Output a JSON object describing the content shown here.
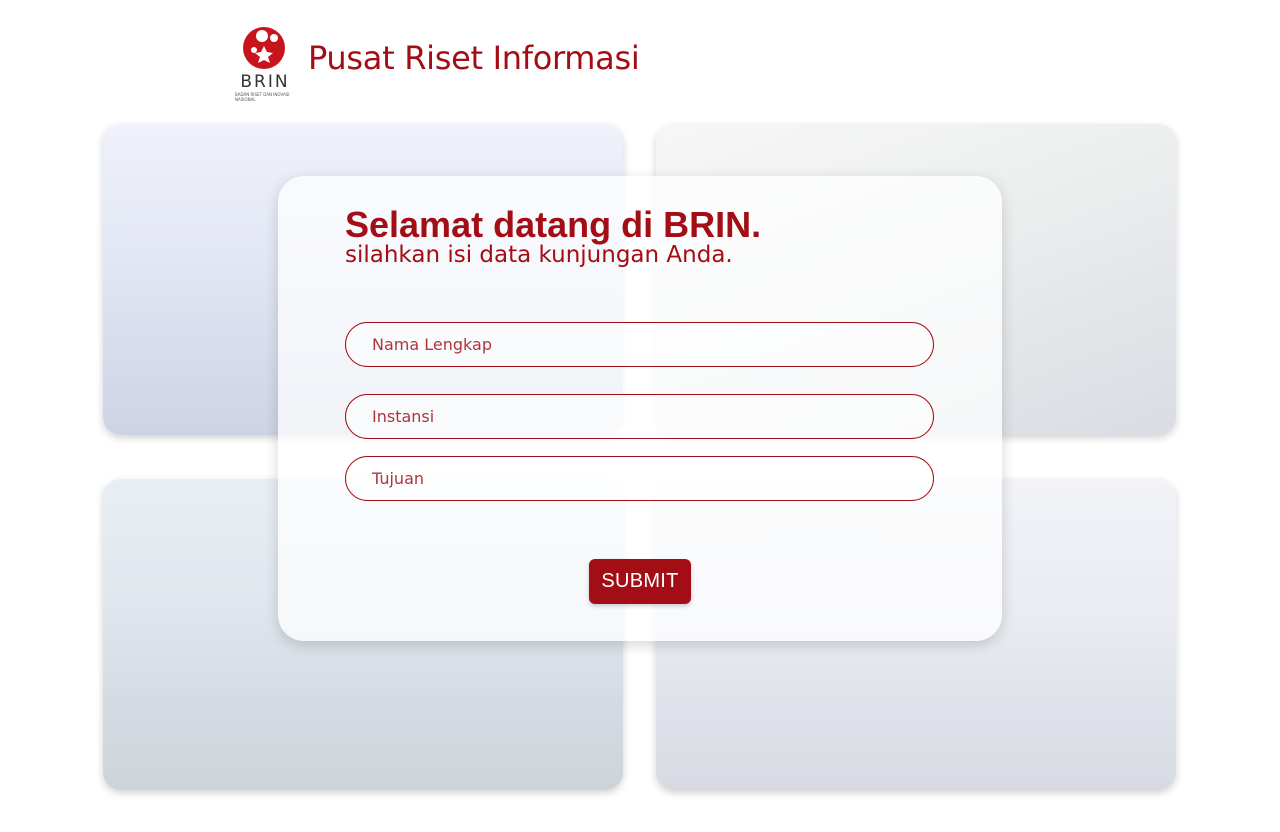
{
  "header": {
    "logo_word": "BRIN",
    "logo_subtext": "BADAN RISET DAN INOVASI NASIONAL",
    "title": "Pusat Riset Informasi"
  },
  "form": {
    "welcome": "Selamat datang di BRIN.",
    "subtitle": "silahkan isi data kunjungan Anda.",
    "fields": [
      {
        "placeholder": "Nama Lengkap",
        "value": ""
      },
      {
        "placeholder": "Instansi",
        "value": ""
      },
      {
        "placeholder": "Tujuan",
        "value": ""
      }
    ],
    "submit_label": "SUBMIT"
  },
  "colors": {
    "brand_red": "#a30d15",
    "background": "#ffffff"
  },
  "icons": {
    "logo": "brin-logo-icon"
  }
}
